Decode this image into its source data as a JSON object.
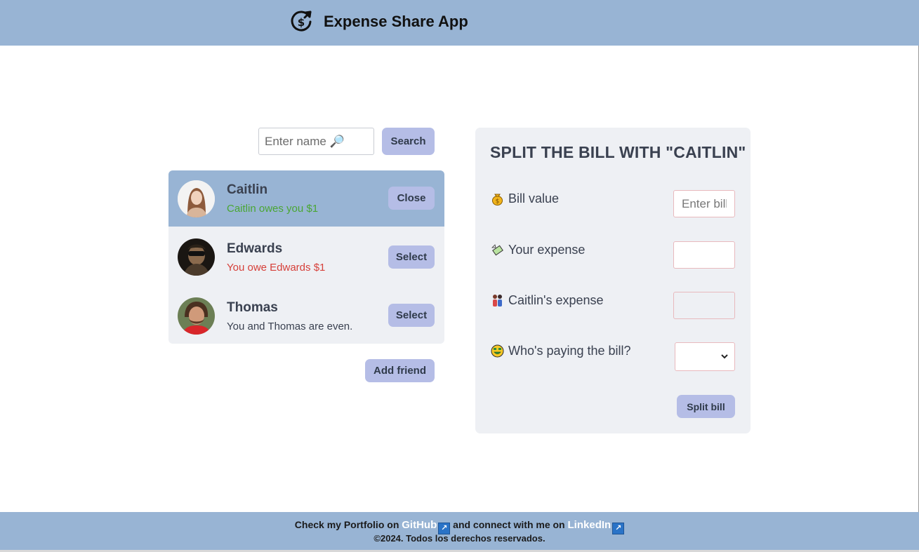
{
  "header": {
    "title": "Expense Share App",
    "logo_icon": "dollar-refresh-icon"
  },
  "search": {
    "placeholder": "Enter name 🔎",
    "button_label": "Search"
  },
  "friends": [
    {
      "name": "Caitlin",
      "status": "Caitlin owes you $1",
      "status_color": "#4aa633",
      "button_label": "Close",
      "selected": true
    },
    {
      "name": "Edwards",
      "status": "You owe Edwards $1",
      "status_color": "#d6403a",
      "button_label": "Select",
      "selected": false
    },
    {
      "name": "Thomas",
      "status": "You and Thomas are even.",
      "status_color": "#3a4150",
      "button_label": "Select",
      "selected": false
    }
  ],
  "add_friend_label": "Add friend",
  "split": {
    "title": "SPLIT THE BILL WITH \"CAITLIN\"",
    "bill_label": "Bill value",
    "bill_placeholder": "Enter bill",
    "your_expense_label": "Your expense",
    "friend_expense_label": "Caitlin's expense",
    "payer_label": "Who's paying the bill?",
    "payer_value": "",
    "submit_label": "Split bill"
  },
  "footer": {
    "text_before": "Check my Portfolio on",
    "github": "GitHub",
    "text_middle": "and connect with me on",
    "linkedin": "LinkedIn",
    "copyright": "©2024. Todos los derechos reservados."
  },
  "colors": {
    "accent": "#98b4d4",
    "button": "#b5bde6",
    "panel": "#eef0f4"
  }
}
